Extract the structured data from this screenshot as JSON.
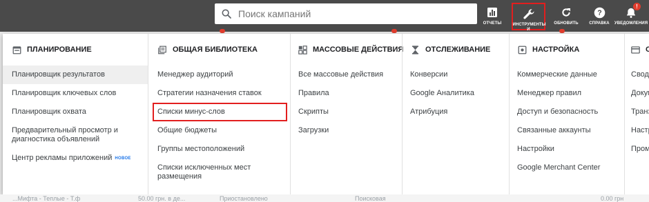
{
  "search": {
    "placeholder": "Поиск кампаний"
  },
  "toolbar": {
    "reports": "Отчеты",
    "tools": "Инструменты и",
    "refresh": "Обновить",
    "help": "Справка",
    "notifications": "Уведомления",
    "badge": "!"
  },
  "columns": [
    {
      "title": "Планирование",
      "icon": "calendar-icon",
      "items": [
        "Планировщик результатов",
        "Планировщик ключевых слов",
        "Планировщик охвата",
        "Предварительный просмотр и диагностика объявлений",
        "Центр рекламы приложений"
      ],
      "new_badge": "НОВОЕ"
    },
    {
      "title": "Общая библиотека",
      "icon": "library-icon",
      "items": [
        "Менеджер аудиторий",
        "Стратегии назначения ставок",
        "Списки минус-слов",
        "Общие бюджеты",
        "Группы местоположений",
        "Списки исключенных мест размещения"
      ]
    },
    {
      "title": "Массовые действия",
      "icon": "bulk-actions-icon",
      "items": [
        "Все массовые действия",
        "Правила",
        "Скрипты",
        "Загрузки"
      ]
    },
    {
      "title": "Отслеживание",
      "icon": "hourglass-icon",
      "items": [
        "Конверсии",
        "Google Аналитика",
        "Атрибуция"
      ]
    },
    {
      "title": "Настройка",
      "icon": "settings-icon",
      "items": [
        "Коммерческие данные",
        "Менеджер правил",
        "Доступ и безопасность",
        "Связанные аккаунты",
        "Настройки",
        "Google Merchant Center"
      ]
    },
    {
      "title": "О",
      "icon": "billing-icon",
      "items": [
        "Своді",
        "Докум",
        "Транз",
        "Настр",
        "Пром"
      ]
    }
  ],
  "background_row": [
    "...Мифта - Теплые - Т.ф",
    "50.00 грн. в де...",
    "Приостановлено",
    "Поисковая",
    "0.00 грн"
  ],
  "colors": {
    "topbar": "#4a4a4a",
    "highlight": "#e21e1e",
    "link": "#1a73e8"
  }
}
